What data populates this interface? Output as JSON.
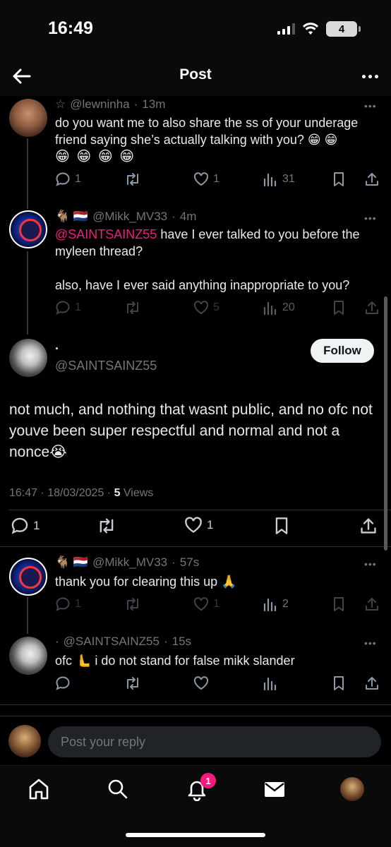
{
  "status": {
    "time": "16:49",
    "battery": "4"
  },
  "header": {
    "title": "Post"
  },
  "tweets": [
    {
      "handle_prefix": "☆",
      "handle": "@lewninha",
      "time": "13m",
      "text": "do you want me to also share the ss of your underage friend saying she’s actually talking with you? 😁 😁",
      "emoji_line": "😁 😁 😁 😁",
      "replies": "1",
      "reposts": "",
      "likes": "1",
      "views": "31"
    },
    {
      "handle_prefix": "🐐 🇳🇱",
      "handle": "@Mikk_MV33",
      "time": "4m",
      "mention": "@SAINTSAINZ55",
      "text_after_mention": " have I ever talked to you before the myleen thread?",
      "text2": "also, have I ever said anything inappropriate to you?",
      "replies": "1",
      "reposts": "",
      "likes": "5",
      "views": "20"
    }
  ],
  "main_post": {
    "name": "·",
    "handle": "@SAINTSAINZ55",
    "follow_label": "Follow",
    "text": "not much, and nothing that wasnt public, and no ofc not youve been super respectful and normal and not a nonce😭",
    "timestamp": "16:47 · 18/03/2025 · ",
    "views_count": "5",
    "views_label": " Views",
    "replies": "1",
    "likes": "1"
  },
  "replies": [
    {
      "handle_prefix": "🐐 🇳🇱",
      "handle": "@Mikk_MV33",
      "time": "57s",
      "text": "thank you for clearing this up 🙏",
      "replies": "1",
      "likes": "1",
      "views": "2"
    },
    {
      "handle_prefix": "·",
      "handle": "@SAINTSAINZ55",
      "time": "15s",
      "text": "ofc 🫷 i do not stand for false mikk slander",
      "replies": "",
      "likes": "",
      "views": ""
    }
  ],
  "reply_bar": {
    "placeholder": "Post your reply"
  },
  "nav": {
    "notifications_badge": "1"
  },
  "colors": {
    "accent_pink": "#f91880",
    "muted": "#71767b",
    "text": "#e7e9ea"
  }
}
